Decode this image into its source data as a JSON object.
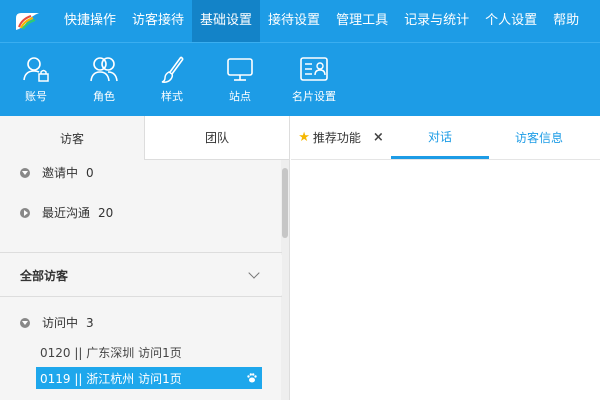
{
  "menu": {
    "items": [
      {
        "label": "快捷操作",
        "active": false
      },
      {
        "label": "访客接待",
        "active": false
      },
      {
        "label": "基础设置",
        "active": true
      },
      {
        "label": "接待设置",
        "active": false
      },
      {
        "label": "管理工具",
        "active": false
      },
      {
        "label": "记录与统计",
        "active": false
      },
      {
        "label": "个人设置",
        "active": false
      },
      {
        "label": "帮助",
        "active": false
      }
    ]
  },
  "toolbar": {
    "items": [
      {
        "label": "账号",
        "icon": "account-lock-icon"
      },
      {
        "label": "角色",
        "icon": "role-users-icon"
      },
      {
        "label": "样式",
        "icon": "brush-icon"
      },
      {
        "label": "站点",
        "icon": "monitor-icon"
      },
      {
        "label": "名片设置",
        "icon": "card-icon"
      }
    ]
  },
  "left_tabs": {
    "visitor": "访客",
    "team": "团队"
  },
  "groups": {
    "inviting": {
      "label": "邀请中",
      "count": "0"
    },
    "recent": {
      "label": "最近沟通",
      "count": "20"
    },
    "all_visitors": "全部访客",
    "visiting": {
      "label": "访问中",
      "count": "3"
    }
  },
  "visitors": [
    {
      "text": "0120 || 广东深圳 访问1页",
      "selected": false
    },
    {
      "text": "0119 || 浙江杭州 访问1页",
      "selected": true
    }
  ],
  "right_tabs": {
    "recommended": "推荐功能",
    "close": "×",
    "chat": "对话",
    "visitor_info": "访客信息"
  },
  "colors": {
    "brand": "#1d9ce6",
    "selected_row": "#1ea7ec",
    "active_menu": "#1383c8",
    "star": "#f5b700"
  }
}
